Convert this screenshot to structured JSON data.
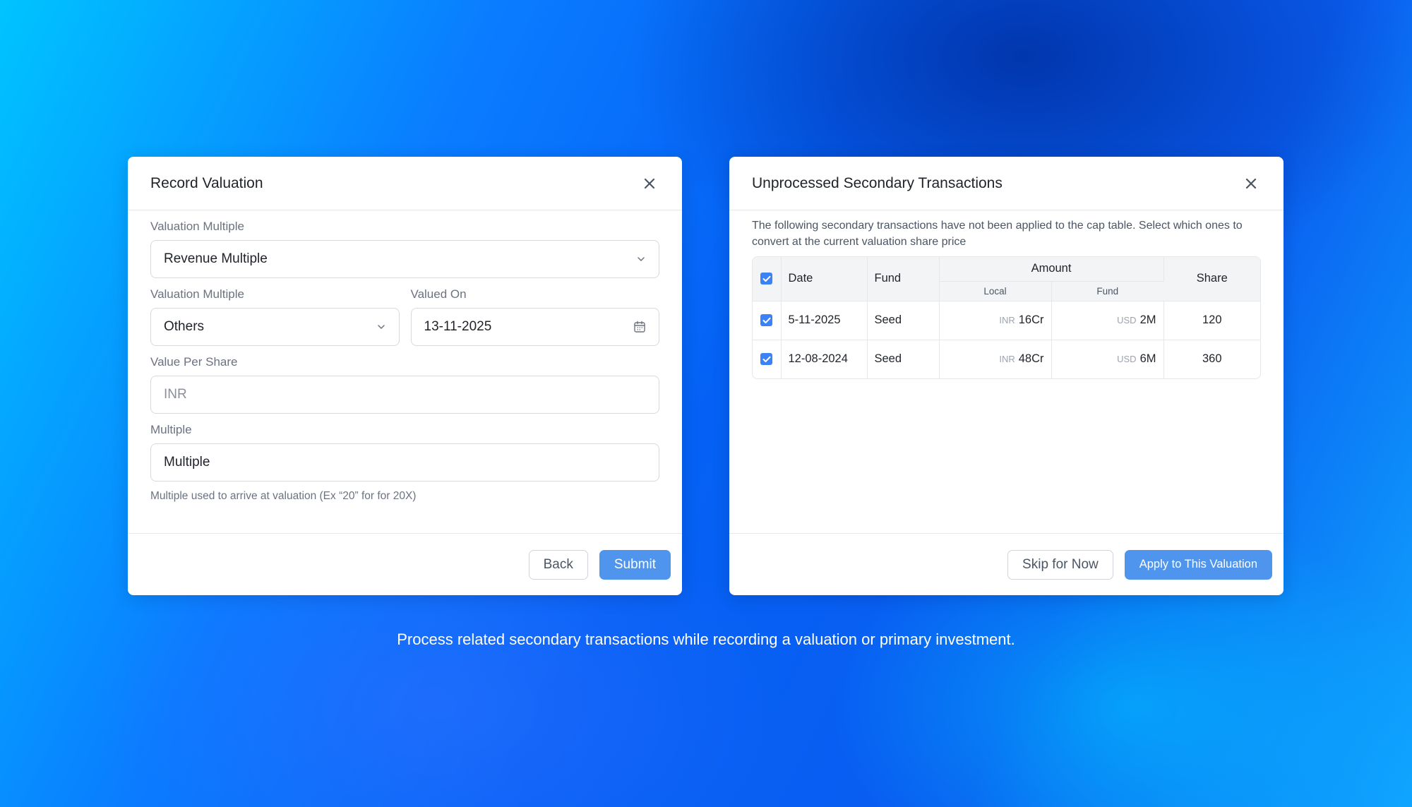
{
  "record_valuation": {
    "title": "Record Valuation",
    "valuation_multiple_label": "Valuation Multiple",
    "valuation_multiple_value": "Revenue Multiple",
    "valuation_multiple2_label": "Valuation Multiple",
    "valuation_multiple2_value": "Others",
    "valued_on_label": "Valued On",
    "valued_on_value": "13-11-2025",
    "value_per_share_label": "Value Per Share",
    "value_per_share_placeholder": "INR",
    "multiple_label": "Multiple",
    "multiple_value": "Multiple",
    "multiple_hint": "Multiple used to arrive at valuation (Ex “20” for for 20X)",
    "back_label": "Back",
    "submit_label": "Submit"
  },
  "secondary": {
    "title": "Unprocessed Secondary Transactions",
    "description": "The following secondary transactions have not been applied to the cap table. Select which ones to convert at the current valuation share price",
    "headers": {
      "date": "Date",
      "fund": "Fund",
      "amount": "Amount",
      "local": "Local",
      "fund_sub": "Fund",
      "share": "Share"
    },
    "rows": [
      {
        "date": "5-11-2025",
        "fund": "Seed",
        "local_cur": "INR",
        "local_amt": "16Cr",
        "fund_cur": "USD",
        "fund_amt": "2M",
        "share": "120"
      },
      {
        "date": "12-08-2024",
        "fund": "Seed",
        "local_cur": "INR",
        "local_amt": "48Cr",
        "fund_cur": "USD",
        "fund_amt": "6M",
        "share": "360"
      }
    ],
    "skip_label": "Skip for Now",
    "apply_label": "Apply to This Valuation"
  },
  "caption": "Process related secondary transactions while recording a valuation or primary investment.",
  "colors": {
    "primary_button": "#4f95ee",
    "checkbox": "#3b82f6"
  },
  "icons": {
    "close": "close-icon",
    "dropdown": "chevron-down-icon",
    "calendar": "calendar-icon",
    "checkbox": "checkmark-icon"
  }
}
